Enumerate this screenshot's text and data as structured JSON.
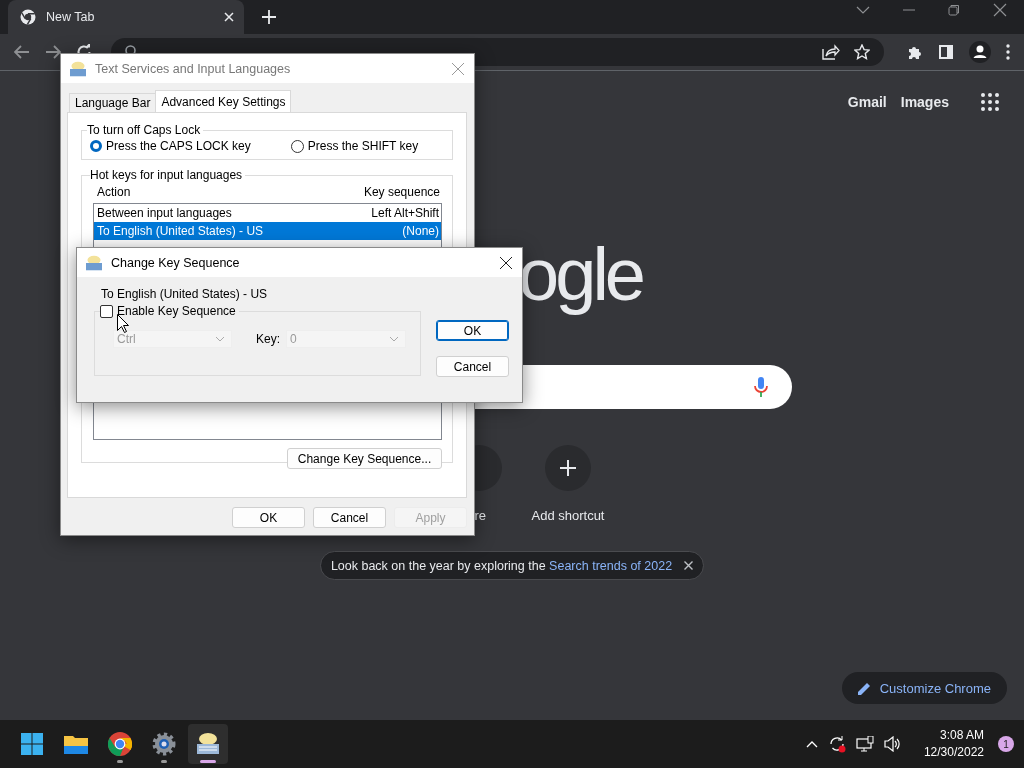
{
  "browser": {
    "tab": {
      "title": "New Tab",
      "selected": true
    },
    "omnibox": {
      "focused": false
    }
  },
  "page": {
    "links": [
      "Gmail",
      "Images"
    ],
    "logo": "ogle",
    "shortcuts": [
      {
        "label": "re",
        "kind": "site"
      },
      {
        "label": "Add shortcut",
        "kind": "add"
      }
    ],
    "promo": {
      "text": "Look back on the year by exploring the",
      "link": "Search trends of 2022"
    },
    "customize": "Customize Chrome"
  },
  "dialog": {
    "title": "Text Services and Input Languages",
    "tabs": [
      {
        "label": "Language Bar",
        "selected": false
      },
      {
        "label": "Advanced Key Settings",
        "selected": true
      }
    ],
    "caps_group": {
      "label": "To turn off Caps Lock",
      "options": [
        {
          "label": "Press the CAPS LOCK key",
          "selected": true
        },
        {
          "label": "Press the SHIFT key",
          "selected": false
        }
      ]
    },
    "hotkeys": {
      "label": "Hot keys for input languages",
      "columns": [
        "Action",
        "Key sequence"
      ],
      "rows": [
        {
          "action": "Between input languages",
          "keys": "Left Alt+Shift",
          "selected": false
        },
        {
          "action": "To English (United States) - US",
          "keys": "(None)",
          "selected": true
        }
      ]
    },
    "change_button": "Change Key Sequence...",
    "buttons": [
      {
        "label": "OK",
        "disabled": false
      },
      {
        "label": "Cancel",
        "disabled": false
      },
      {
        "label": "Apply",
        "disabled": true
      }
    ]
  },
  "subdialog": {
    "title": "Change Key Sequence",
    "target": "To English (United States) - US",
    "enable": {
      "label": "Enable Key Sequence",
      "checked": false
    },
    "modifier": {
      "value": "Ctrl",
      "disabled": true
    },
    "key": {
      "label": "Key:",
      "value": "0",
      "disabled": true
    },
    "buttons": [
      {
        "label": "OK",
        "default": true
      },
      {
        "label": "Cancel",
        "default": false
      }
    ]
  },
  "taskbar": {
    "apps": [
      {
        "kind": "start",
        "running": false,
        "active": false
      },
      {
        "kind": "files",
        "running": false,
        "active": false
      },
      {
        "kind": "browser",
        "running": true,
        "active": false
      },
      {
        "kind": "settings",
        "running": true,
        "active": false
      },
      {
        "kind": "keyboard",
        "running": true,
        "active": true
      }
    ],
    "time": "3:08 AM",
    "date": "12/30/2022",
    "notifications": "1"
  }
}
